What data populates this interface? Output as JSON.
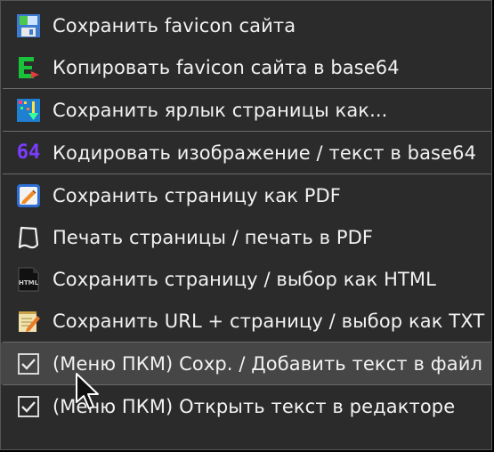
{
  "menu": {
    "items": [
      {
        "label": "Сохранить favicon сайта",
        "icon": "save-favicon-icon"
      },
      {
        "label": "Копировать favicon сайта в base64",
        "icon": "copy-base64-favicon-icon"
      },
      {
        "label": "Сохранить ярлык страницы как...",
        "icon": "save-shortcut-icon"
      },
      {
        "label": "Кодировать изображение / текст в base64",
        "icon": "base64-64-icon",
        "icon_text": "64"
      },
      {
        "label": "Сохранить страницу как PDF",
        "icon": "save-pdf-icon"
      },
      {
        "label": "Печать страницы / печать в PDF",
        "icon": "print-icon"
      },
      {
        "label": "Сохранить страницу / выбор как HTML",
        "icon": "html-file-icon",
        "icon_text": "HTML"
      },
      {
        "label": "Сохранить URL + страницу / выбор как TXT",
        "icon": "txt-notepad-icon"
      },
      {
        "label": "(Меню ПКМ) Сохр. / Добавить текст в файл",
        "icon": "checkbox-checked",
        "checked": true
      },
      {
        "label": "(Меню ПКМ) Открыть текст в редакторе",
        "icon": "checkbox-checked",
        "checked": true
      }
    ]
  },
  "colors": {
    "background": "#2b2b2b",
    "highlight": "#464646",
    "separator": "#6a6a6a",
    "text": "#f2f2f2",
    "base64_purple": "#7b3cff",
    "favicon_green": "#19c23a"
  }
}
